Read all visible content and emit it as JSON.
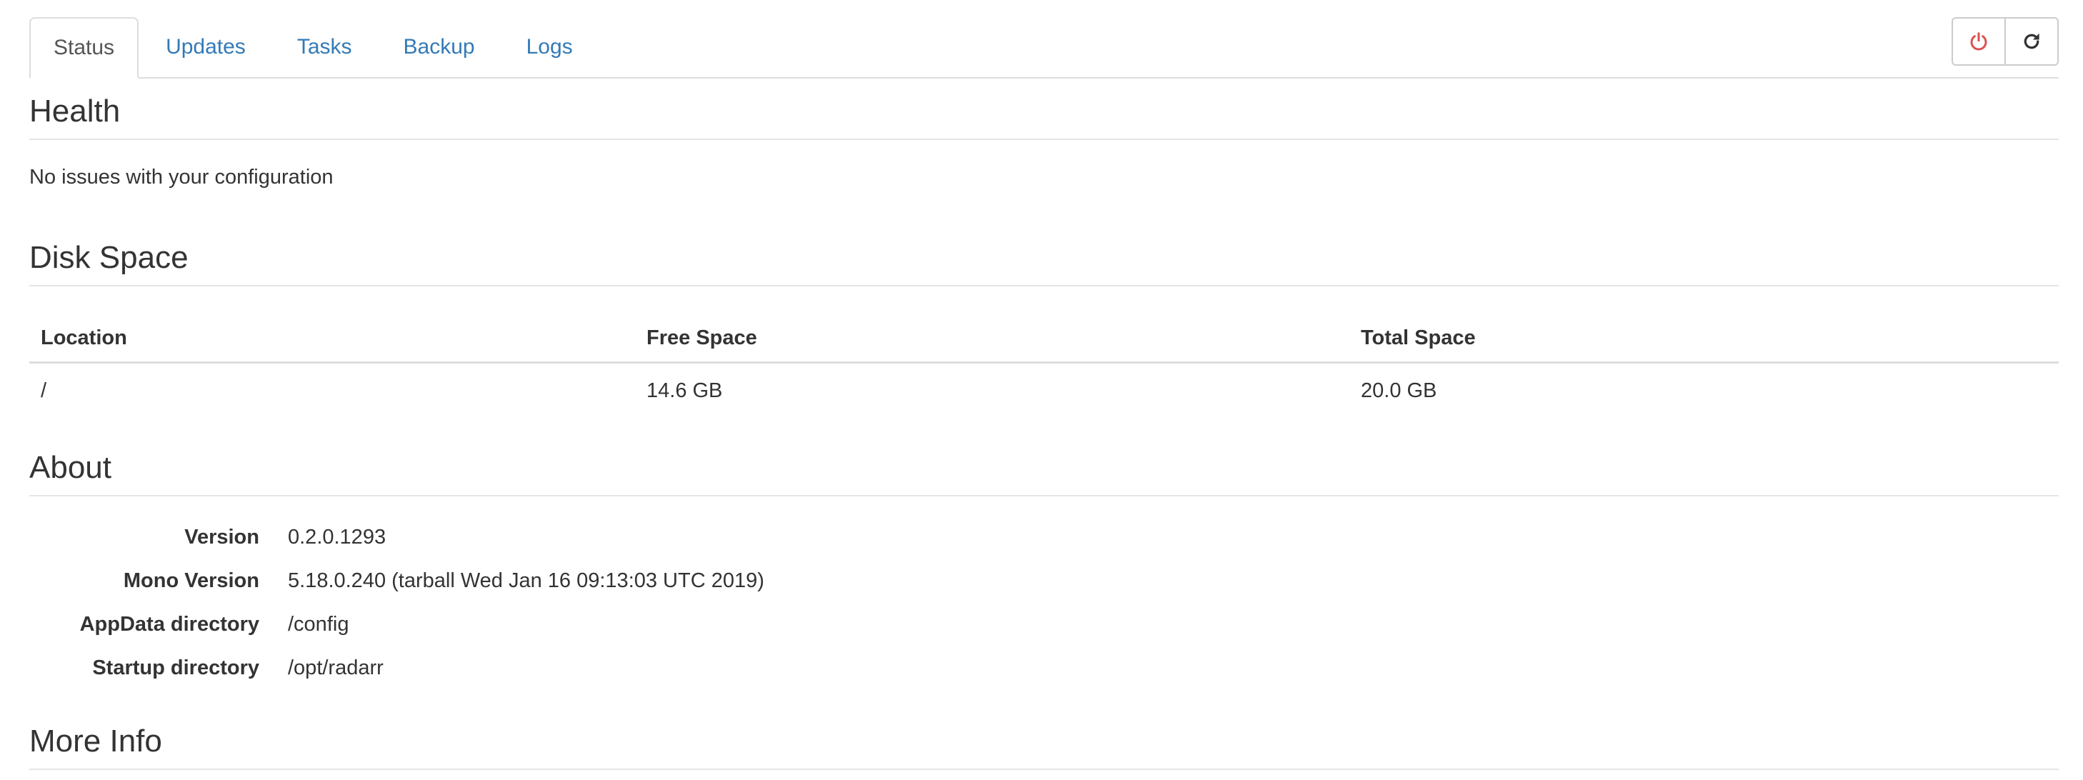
{
  "tabs": [
    {
      "label": "Status",
      "active": true
    },
    {
      "label": "Updates",
      "active": false
    },
    {
      "label": "Tasks",
      "active": false
    },
    {
      "label": "Backup",
      "active": false
    },
    {
      "label": "Logs",
      "active": false
    }
  ],
  "toolbar": {
    "shutdown_icon": "power-icon",
    "restart_icon": "refresh-icon",
    "shutdown_color": "#d9534f"
  },
  "health": {
    "title": "Health",
    "message": "No issues with your configuration"
  },
  "disk_space": {
    "title": "Disk Space",
    "columns": [
      "Location",
      "Free Space",
      "Total Space"
    ],
    "rows": [
      {
        "location": "/",
        "free": "14.6 GB",
        "total": "20.0 GB"
      }
    ]
  },
  "about": {
    "title": "About",
    "items": [
      {
        "label": "Version",
        "value": "0.2.0.1293"
      },
      {
        "label": "Mono Version",
        "value": "5.18.0.240 (tarball Wed Jan 16 09:13:03 UTC 2019)"
      },
      {
        "label": "AppData directory",
        "value": "/config"
      },
      {
        "label": "Startup directory",
        "value": "/opt/radarr"
      }
    ]
  },
  "more_info": {
    "title": "More Info"
  },
  "colors": {
    "link": "#337ab7",
    "text": "#333333",
    "border": "#dddddd",
    "danger": "#d9534f"
  }
}
